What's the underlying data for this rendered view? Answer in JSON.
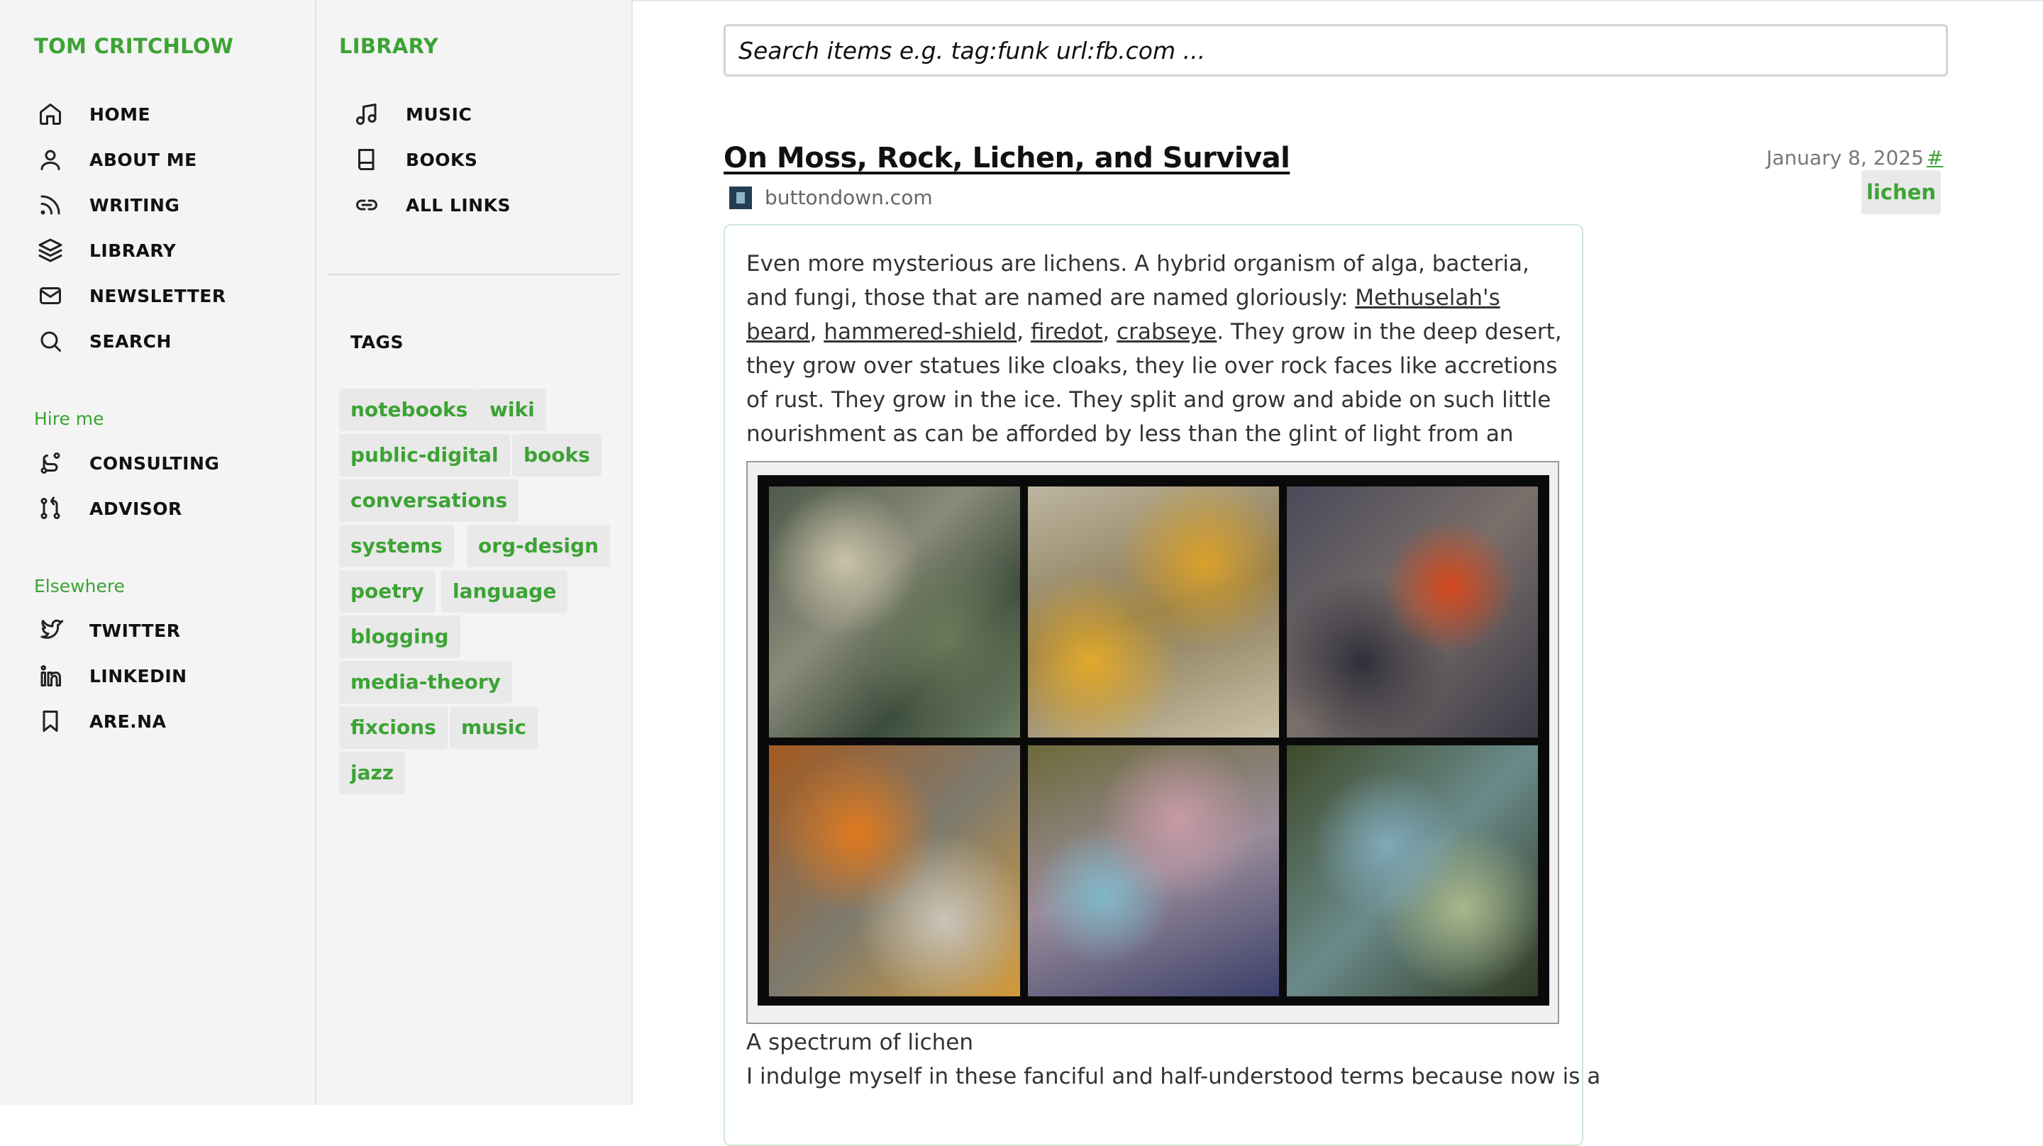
{
  "left_sidebar": {
    "brand": "TOM CRITCHLOW",
    "nav": [
      {
        "label": "HOME",
        "icon": "home-icon"
      },
      {
        "label": "ABOUT ME",
        "icon": "user-icon"
      },
      {
        "label": "WRITING",
        "icon": "rss-icon"
      },
      {
        "label": "LIBRARY",
        "icon": "layers-icon"
      },
      {
        "label": "NEWSLETTER",
        "icon": "mail-icon"
      },
      {
        "label": "SEARCH",
        "icon": "search-icon"
      }
    ],
    "hire_title": "Hire me",
    "hire": [
      {
        "label": "CONSULTING",
        "icon": "route-icon"
      },
      {
        "label": "ADVISOR",
        "icon": "git-pull-icon"
      }
    ],
    "elsewhere_title": "Elsewhere",
    "elsewhere": [
      {
        "label": "TWITTER",
        "icon": "twitter-icon"
      },
      {
        "label": "LINKEDIN",
        "icon": "linkedin-icon"
      },
      {
        "label": "ARE.NA",
        "icon": "bookmark-icon"
      }
    ]
  },
  "library": {
    "title": "LIBRARY",
    "items": [
      {
        "label": "MUSIC",
        "icon": "music-icon"
      },
      {
        "label": "BOOKS",
        "icon": "book-icon"
      },
      {
        "label": "ALL LINKS",
        "icon": "link-icon"
      }
    ],
    "tags_title": "TAGS",
    "tags": [
      "notebooks",
      "wiki",
      "public-digital",
      "books",
      "conversations",
      "systems",
      "org-design",
      "poetry",
      "language",
      "blogging",
      "media-theory",
      "fixcions",
      "music",
      "jazz"
    ]
  },
  "search": {
    "placeholder": "Search items e.g. tag:funk url:fb.com ..."
  },
  "post": {
    "title": "On Moss, Rock, Lichen, and Survival",
    "domain": "buttondown.com",
    "date": "January 8, 2025",
    "hash": "#",
    "tag": "lichen",
    "p1": "Even more mysterious are lichens. A hybrid organism of alga, bacteria, and fungi, those that are named are named gloriously: ",
    "link1": "Methuselah's beard",
    "sep1": ", ",
    "link2": "hammered-shield",
    "sep2": ", ",
    "link3": "firedot",
    "sep3": ", ",
    "link4": "crabseye",
    "p2": ". They grow in the deep desert, they grow over statues like cloaks, they lie over rock faces like accretions of rust. They grow in the ice. They split and grow and abide on such little nourishment as can be afforded by less than the glint of light from an eye.",
    "caption": "A spectrum of lichen",
    "continuation": "I indulge myself in these fanciful and half-understood terms because now is a"
  }
}
